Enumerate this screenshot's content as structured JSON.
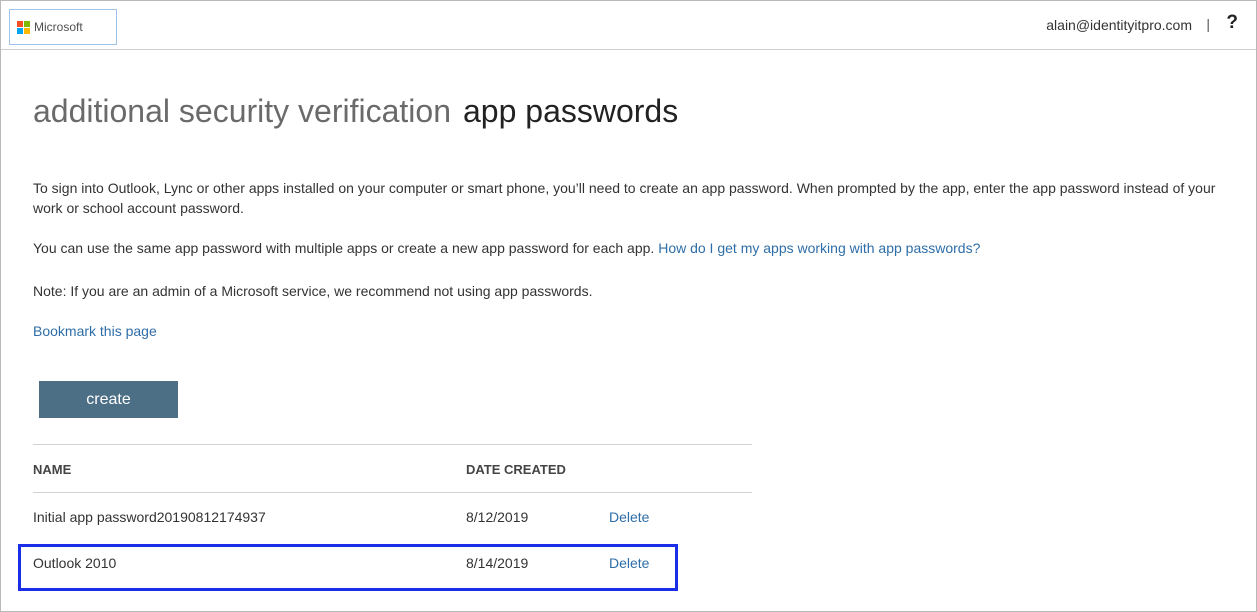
{
  "header": {
    "brand": "Microsoft",
    "logo_colors": [
      "#f25022",
      "#7fba00",
      "#00a4ef",
      "#ffb900"
    ],
    "user_email": "alain@identityitpro.com",
    "separator": "|",
    "help": "?"
  },
  "page": {
    "title": "additional security verification",
    "subtitle": "app passwords",
    "para1": "To sign into Outlook, Lync or other apps installed on your computer or smart phone, you’ll need to create an app password. When prompted by the app, enter the app password instead of your work or school account password.",
    "para2_text": "You can use the same app password with multiple apps or create a new app password for each app.",
    "para2_link": "How do I get my apps working with app passwords?",
    "para3": "Note: If you are an admin of a Microsoft service, we recommend not using app passwords.",
    "bookmark_link": "Bookmark this page",
    "create_label": "create"
  },
  "table": {
    "headers": [
      "NAME",
      "DATE CREATED"
    ],
    "rows": [
      {
        "name": "Initial app password20190812174937",
        "date": "8/12/2019",
        "action": "Delete"
      },
      {
        "name": "Outlook 2010",
        "date": "8/14/2019",
        "action": "Delete",
        "highlighted": true
      }
    ]
  },
  "colors": {
    "accent_button": "#4d6f86",
    "link": "#2e6ea8",
    "highlight_border": "#1a2ee8"
  }
}
